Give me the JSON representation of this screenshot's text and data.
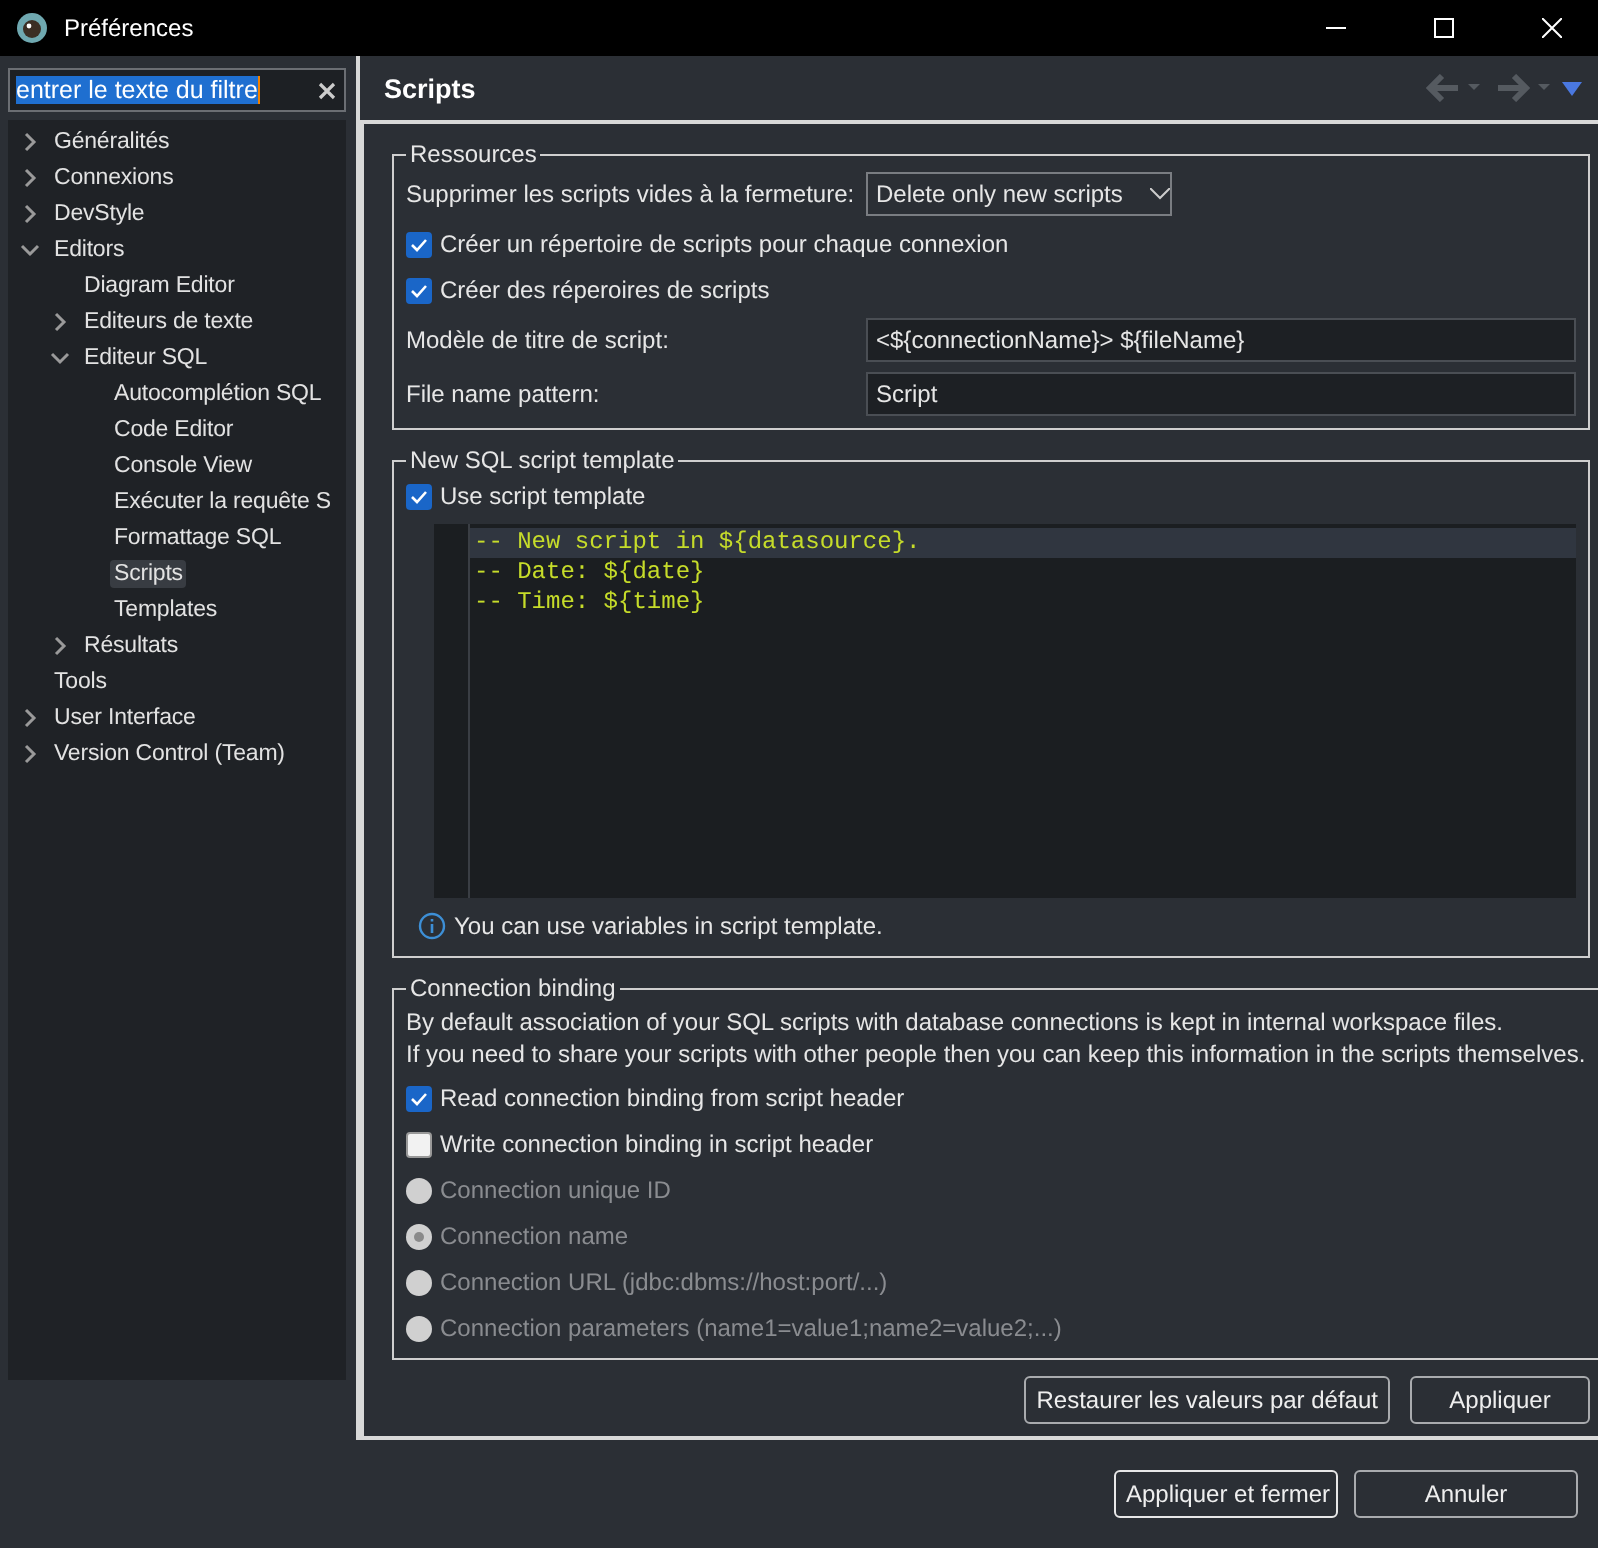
{
  "window": {
    "title": "Préférences"
  },
  "filter": {
    "value": "entrer le texte du filtre"
  },
  "tree": [
    {
      "label": "Généralités",
      "expanded": false,
      "selected": false
    },
    {
      "label": "Connexions",
      "expanded": false,
      "selected": false
    },
    {
      "label": "DevStyle",
      "expanded": false,
      "selected": false
    },
    {
      "label": "Editors",
      "expanded": true,
      "selected": false,
      "children": [
        {
          "label": "Diagram Editor",
          "selected": false
        },
        {
          "label": "Editeurs de texte",
          "expanded": false,
          "selected": false
        },
        {
          "label": "Editeur SQL",
          "expanded": true,
          "selected": false,
          "children": [
            {
              "label": "Autocomplétion SQL",
              "selected": false
            },
            {
              "label": "Code Editor",
              "selected": false
            },
            {
              "label": "Console View",
              "selected": false
            },
            {
              "label": "Exécuter la requête S",
              "selected": false
            },
            {
              "label": "Formattage SQL",
              "selected": false
            },
            {
              "label": "Scripts",
              "selected": true
            },
            {
              "label": "Templates",
              "selected": false
            }
          ]
        },
        {
          "label": "Résultats",
          "expanded": false,
          "selected": false
        }
      ]
    },
    {
      "label": "Tools",
      "selected": false
    },
    {
      "label": "User Interface",
      "expanded": false,
      "selected": false
    },
    {
      "label": "Version Control (Team)",
      "expanded": false,
      "selected": false
    }
  ],
  "page": {
    "title": "Scripts"
  },
  "resources": {
    "title": "Ressources",
    "select": {
      "label": "Supprimer les scripts vides à la fermeture:",
      "value": "Delete only new scripts"
    },
    "checkboxes": [
      {
        "label": "Créer un répertoire de scripts pour chaque connexion",
        "checked": true
      },
      {
        "label": "Créer des réperoires de scripts",
        "checked": true
      }
    ],
    "fields": [
      {
        "label": "Modèle de titre de script:",
        "value": "<${connectionName}> ${fileName}"
      },
      {
        "label": "File name pattern:",
        "value": "Script"
      }
    ]
  },
  "template": {
    "title": "New SQL script template",
    "checkbox": {
      "label": "Use script template",
      "checked": true
    },
    "code": [
      "-- New script in ${datasource}.",
      "-- Date: ${date}",
      "-- Time: ${time}"
    ],
    "info": "You can use variables in script template."
  },
  "binding": {
    "title": "Connection binding",
    "description": [
      "By default association of your SQL scripts with database connections is kept in internal workspace files.",
      "If you need to share your scripts with other people then you can keep this information in the scripts themselves."
    ],
    "checkboxes": [
      {
        "label": "Read connection binding from script header",
        "checked": true
      },
      {
        "label": "Write connection binding in script header",
        "checked": false
      }
    ],
    "radios": [
      {
        "label": "Connection unique ID",
        "selected": false,
        "disabled": true
      },
      {
        "label": "Connection name",
        "selected": true,
        "disabled": true
      },
      {
        "label": "Connection URL (jdbc:dbms://host:port/...)",
        "selected": false,
        "disabled": true
      },
      {
        "label": "Connection parameters (name1=value1;name2=value2;...)",
        "selected": false,
        "disabled": true
      }
    ]
  },
  "page_buttons": [
    "Restaurer les valeurs par défaut",
    "Appliquer"
  ],
  "footer_buttons": [
    {
      "label": "Appliquer et fermer",
      "default": true
    },
    {
      "label": "Annuler",
      "default": false
    }
  ]
}
